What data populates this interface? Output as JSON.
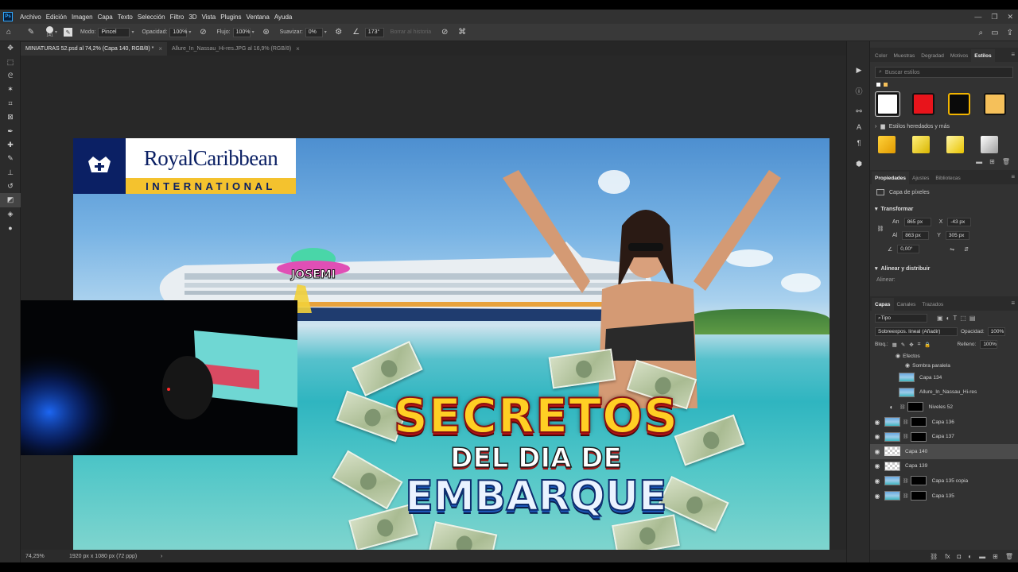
{
  "menu": {
    "logo": "Ps",
    "items": [
      "Archivo",
      "Edición",
      "Imagen",
      "Capa",
      "Texto",
      "Selección",
      "Filtro",
      "3D",
      "Vista",
      "Plugins",
      "Ventana",
      "Ayuda"
    ]
  },
  "options": {
    "brush_size": "141",
    "mode_label": "Modo:",
    "mode_value": "Pincel",
    "opacity_label": "Opacidad:",
    "opacity_value": "100%",
    "flow_label": "Flujo:",
    "flow_value": "100%",
    "smooth_label": "Suavizar:",
    "smooth_value": "0%",
    "angle_value": "173°",
    "history_label": "Borrar al historia"
  },
  "tabs": [
    {
      "label": "MINIATURAS 52.psd al 74,2% (Capa 140, RGB/8) *",
      "active": true
    },
    {
      "label": "Allure_In_Nassau_Hi-res.JPG al 16,9% (RGB/8)",
      "active": false
    }
  ],
  "canvas": {
    "logo_name": "RoyalCaribbean",
    "logo_sub": "INTERNATIONAL",
    "sticker": "JOSEMI",
    "title_line1": "SECRETOS",
    "title_line2": "DEL DIA DE",
    "title_line3": "EMBARQUE"
  },
  "status": {
    "zoom": "74,25%",
    "doc_size": "1920 px x 1080 px (72 ppp)"
  },
  "styles_panel": {
    "tabs": [
      "Color",
      "Muestras",
      "Degradad",
      "Motivos",
      "Estilos"
    ],
    "search_placeholder": "Buscar estilos",
    "folder_label": "Estilos heredados y más",
    "swatches": [
      "#ffffff",
      "#e8141b",
      "#0a0a0a",
      "#f5c05a"
    ]
  },
  "properties": {
    "tabs": [
      "Propiedades",
      "Ajustes",
      "Bibliotecas"
    ],
    "layer_kind": "Capa de píxeles",
    "transform_label": "Transformar",
    "w_label": "An",
    "w_value": "865 px",
    "x_label": "X",
    "x_value": "-43 px",
    "h_label": "Al",
    "h_value": "863 px",
    "y_label": "Y",
    "y_value": "305 px",
    "angle_value": "0,00°",
    "align_label": "Alinear y distribuir",
    "align_sub": "Alinear:"
  },
  "layers_panel": {
    "tabs": [
      "Capas",
      "Canales",
      "Trazados"
    ],
    "filter_value": "Tipo",
    "blend_mode": "Sobreexpos. lineal (Añadir)",
    "opacity_label": "Opacidad:",
    "opacity_value": "100%",
    "lock_label": "Bloq.:",
    "fill_label": "Relleno:",
    "fill_value": "100%",
    "effects_label": "Efectos",
    "shadow_label": "Sombra paralela",
    "layers": [
      {
        "name": "Capa 134",
        "visible": false,
        "mask": false,
        "thumb": "sky",
        "selected": false
      },
      {
        "name": "Allure_In_Nassau_Hi-res",
        "visible": false,
        "mask": false,
        "thumb": "sky",
        "selected": false
      },
      {
        "name": "Niveles 52",
        "visible": false,
        "mask": true,
        "thumb": "adjust",
        "selected": false
      },
      {
        "name": "Capa 136",
        "visible": true,
        "mask": true,
        "thumb": "sky",
        "selected": false
      },
      {
        "name": "Capa 137",
        "visible": true,
        "mask": true,
        "thumb": "sky",
        "selected": false
      },
      {
        "name": "Capa 140",
        "visible": true,
        "mask": false,
        "thumb": "empty",
        "selected": true
      },
      {
        "name": "Capa 139",
        "visible": true,
        "mask": false,
        "thumb": "empty",
        "selected": false
      },
      {
        "name": "Capa 135 copia",
        "visible": true,
        "mask": true,
        "thumb": "sky",
        "selected": false
      },
      {
        "name": "Capa 135",
        "visible": true,
        "mask": true,
        "thumb": "sky",
        "selected": false
      }
    ]
  }
}
